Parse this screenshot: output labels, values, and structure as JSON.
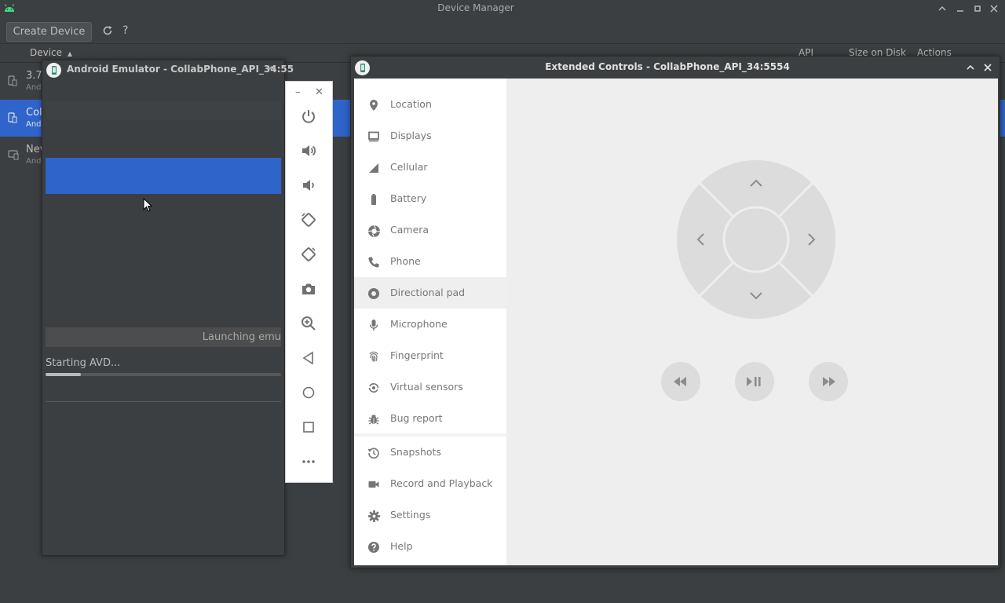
{
  "device_manager": {
    "title": "Device Manager",
    "create_device_label": "Create Device",
    "help_label": "?",
    "columns": {
      "device": "Device",
      "api": "API",
      "size_on_disk": "Size on Disk",
      "actions": "Actions"
    },
    "rows": [
      {
        "title": "3.7",
        "subtitle": "And"
      },
      {
        "title": "Col",
        "subtitle": "And"
      },
      {
        "title": "Nev",
        "subtitle": "And"
      }
    ]
  },
  "emulator": {
    "title": "Android Emulator - CollabPhone_API_34:55",
    "launch_text": "Launching emu",
    "status_text": "Starting AVD...",
    "progress": 0.15
  },
  "toolbar": {
    "minimize": "–",
    "close": "✕",
    "buttons": [
      "power-icon",
      "volume-up-icon",
      "volume-down-icon",
      "rotate-left-icon",
      "rotate-right-icon",
      "camera-icon",
      "zoom-icon",
      "back-icon",
      "home-icon",
      "overview-icon",
      "more-icon"
    ]
  },
  "extended_controls": {
    "title": "Extended Controls - CollabPhone_API_34:5554",
    "active_item": "Directional pad",
    "nav": [
      {
        "label": "Location",
        "icon": "location-icon"
      },
      {
        "label": "Displays",
        "icon": "displays-icon"
      },
      {
        "label": "Cellular",
        "icon": "cellular-icon"
      },
      {
        "label": "Battery",
        "icon": "battery-icon"
      },
      {
        "label": "Camera",
        "icon": "camera-icon"
      },
      {
        "label": "Phone",
        "icon": "phone-icon"
      },
      {
        "label": "Directional pad",
        "icon": "dpad-icon"
      },
      {
        "label": "Microphone",
        "icon": "microphone-icon"
      },
      {
        "label": "Fingerprint",
        "icon": "fingerprint-icon"
      },
      {
        "label": "Virtual sensors",
        "icon": "sensors-icon"
      },
      {
        "label": "Bug report",
        "icon": "bug-icon"
      },
      {
        "label": "Snapshots",
        "icon": "snapshots-icon"
      },
      {
        "label": "Record and Playback",
        "icon": "record-icon"
      },
      {
        "label": "Settings",
        "icon": "settings-icon"
      },
      {
        "label": "Help",
        "icon": "help-icon"
      }
    ]
  },
  "colors": {
    "accent": "#2f65ca",
    "dark_bg": "#3c3f41",
    "icon_gray": "#707070",
    "dpad_gray": "#dcdcdc"
  }
}
